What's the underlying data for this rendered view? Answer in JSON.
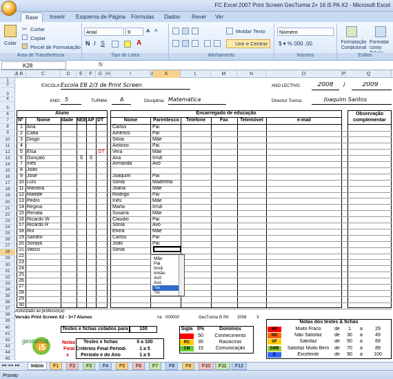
{
  "window": {
    "title": "FC Excel 2007 Print Screen GesTurma 2+ 16 i5 PA X2 - Microsoft Excel"
  },
  "ribbon": {
    "tabs": [
      "Base",
      "Inserir",
      "Esquema de Página",
      "Fórmulas",
      "Dados",
      "Rever",
      "Ver"
    ],
    "colar": "Colar",
    "cortar": "Cortar",
    "copiar": "Copiar",
    "pincel": "Pincel de Formatação",
    "font_name": "Arial",
    "font_size": "9",
    "font_group": "Tipo de Letra",
    "clip_group": "Área de Transferência",
    "moldar": "Moldar Texto",
    "unir": "Unir e Centrar",
    "align_group": "Alinhamento",
    "num_format": "Número",
    "num_group": "Número",
    "cond_format": "Formatação Condicional",
    "table_format": "Formatar como Tabela",
    "styles_group": "Estilos"
  },
  "formula": {
    "namebox": "K28",
    "fx": "fx",
    "value": ""
  },
  "columns": [
    "A",
    "B",
    "C",
    "D",
    "E",
    "F",
    "G",
    "H",
    "I",
    "J",
    "K",
    "L",
    "M",
    "N",
    "O",
    "P",
    "Q",
    "R"
  ],
  "rows": [
    "1",
    "2",
    "3",
    "4",
    "5",
    "6",
    "7",
    "8",
    "9",
    "10",
    "11",
    "12",
    "13",
    "14",
    "15",
    "16",
    "17",
    "18",
    "19",
    "20",
    "21",
    "22",
    "23",
    "24",
    "25",
    "26",
    "27",
    "28",
    "29",
    "30",
    "31",
    "32",
    "33",
    "34",
    "35",
    "36",
    "37",
    "38",
    "39",
    "40",
    "41",
    "42",
    "43",
    "44",
    "45"
  ],
  "header": {
    "escola_label": "ESCOLA:",
    "escola": "Escola EB 2/3 de Print Screen",
    "ano_lectivo_label": "ANO LECTIVO:",
    "year1": "2008",
    "slash": "/",
    "year2": "2009",
    "ano_label": "ANO:",
    "ano": "5",
    "turma_label": "TURMA:",
    "turma": "A",
    "disciplina_label": "Disciplina:",
    "disciplina": "Matemática",
    "director_label": "Director Turma:",
    "director": "Joaquim Santos"
  },
  "table_headers": {
    "aluno": "Aluno",
    "encarregado": "Encarregado de educação",
    "observacao": "Observação complementar",
    "n": "Nº",
    "nome": "Nome",
    "idade": "Idade",
    "nee": "NEE",
    "ap": "AP",
    "dt": "DT",
    "enc_nome": "Nome",
    "parentesco": "Parentesco",
    "telefone": "Telefone",
    "fax": "Fax",
    "telemovel": "Telemóvel",
    "email": "e-mail"
  },
  "students": [
    {
      "n": "1",
      "nome": "Ana",
      "nee": "",
      "ap": "",
      "dt": "",
      "enc": "Carlos",
      "par": "Pai"
    },
    {
      "n": "2",
      "nome": "Cátia",
      "nee": "",
      "ap": "",
      "dt": "",
      "enc": "Américo",
      "par": "Pai"
    },
    {
      "n": "3",
      "nome": "Diogo",
      "nee": "",
      "ap": "",
      "dt": "",
      "enc": "Silvia",
      "par": "Mãe"
    },
    {
      "n": "4",
      "nome": "",
      "nee": "",
      "ap": "",
      "dt": "",
      "enc": "António",
      "par": "Pai"
    },
    {
      "n": "5",
      "nome": "Elsa",
      "nee": "",
      "ap": "",
      "dt": "DT",
      "enc": "Vera",
      "par": "Mãe"
    },
    {
      "n": "6",
      "nome": "Gonçalo",
      "nee": "S",
      "ap": "S",
      "dt": "",
      "enc": "Ana",
      "par": "Irmã"
    },
    {
      "n": "7",
      "nome": "Inês",
      "nee": "",
      "ap": "",
      "dt": "",
      "enc": "Armanda",
      "par": "Avó"
    },
    {
      "n": "8",
      "nome": "João",
      "nee": "",
      "ap": "",
      "dt": "",
      "enc": "",
      "par": ""
    },
    {
      "n": "9",
      "nome": "José",
      "nee": "",
      "ap": "",
      "dt": "",
      "enc": "Joaquim",
      "par": "Pai"
    },
    {
      "n": "10",
      "nome": "Luís",
      "nee": "",
      "ap": "",
      "dt": "",
      "enc": "Sónia",
      "par": "Madrinha"
    },
    {
      "n": "11",
      "nome": "Mariana",
      "nee": "",
      "ap": "",
      "dt": "",
      "enc": "Joana",
      "par": "Mãe"
    },
    {
      "n": "12",
      "nome": "Matilde",
      "nee": "",
      "ap": "",
      "dt": "",
      "enc": "Rodrigo",
      "par": "Pai"
    },
    {
      "n": "13",
      "nome": "Pedro",
      "nee": "",
      "ap": "",
      "dt": "",
      "enc": "Inês",
      "par": "Mãe"
    },
    {
      "n": "14",
      "nome": "Regina",
      "nee": "",
      "ap": "",
      "dt": "",
      "enc": "Marta",
      "par": "Irmã"
    },
    {
      "n": "15",
      "nome": "Renata",
      "nee": "",
      "ap": "",
      "dt": "",
      "enc": "Susana",
      "par": "Mãe"
    },
    {
      "n": "16",
      "nome": "Ricardo W",
      "nee": "",
      "ap": "",
      "dt": "",
      "enc": "Claudio",
      "par": "Pai"
    },
    {
      "n": "17",
      "nome": "Ricardo R",
      "nee": "",
      "ap": "",
      "dt": "",
      "enc": "Sónia",
      "par": "Avó"
    },
    {
      "n": "18",
      "nome": "Rui",
      "nee": "",
      "ap": "",
      "dt": "",
      "enc": "Elvira",
      "par": "Mãe"
    },
    {
      "n": "19",
      "nome": "Sandro",
      "nee": "",
      "ap": "",
      "dt": "",
      "enc": "Carlos",
      "par": "Pai"
    },
    {
      "n": "20",
      "nome": "Soraya",
      "nee": "",
      "ap": "",
      "dt": "",
      "enc": "João",
      "par": "Pai"
    },
    {
      "n": "21",
      "nome": "Vasco",
      "nee": "",
      "ap": "",
      "dt": "",
      "enc": "Sónia",
      "par": ""
    },
    {
      "n": "22"
    },
    {
      "n": "23"
    },
    {
      "n": "24"
    },
    {
      "n": "25"
    },
    {
      "n": "26"
    },
    {
      "n": "27"
    },
    {
      "n": "28"
    },
    {
      "n": "29"
    },
    {
      "n": "30"
    }
  ],
  "dropdown": {
    "items": [
      "Mãe",
      "Pai",
      "Irmã",
      "Irmão",
      "Avô",
      "Avó",
      "Tia",
      "Tio"
    ],
    "selected": "Tia"
  },
  "footer": {
    "autorizado": "Autorizado ao professor(a):",
    "versao": "Versão Print Screen X2 - 3+7 Alunos",
    "na": "na",
    "na_num": "000000",
    "gesturma": "GesTurma i5 PA",
    "year": "2008",
    "x": "X",
    "testes_label": "Testes e fichas cotados para",
    "testes_val": "100",
    "notas": "Notas",
    "final": "Final",
    "s": "s",
    "tf_label": "Testes e fichas",
    "tf_val": "0 a 100",
    "cfp_label": "Critérios Final Período",
    "cfp_val": "1 a 5",
    "pa_label": "Período e do Ano",
    "pa_val": "1 a 5"
  },
  "siglas": {
    "h1": "Sigla",
    "h2": "0%",
    "h3": "Domínios",
    "rows": [
      {
        "s": "",
        "p": "50",
        "d": "Conhecimento",
        "c": "#ff0000"
      },
      {
        "s": "RC",
        "p": "35",
        "d": "Raciocínio",
        "c": "#ffcc00"
      },
      {
        "s": "CM",
        "p": "15",
        "d": "Comunicação",
        "c": "#66cc33"
      }
    ]
  },
  "notas": {
    "title": "Notas dos testes & fichas",
    "rows": [
      {
        "s": "MF",
        "t": "Muito Fraco",
        "de": "1",
        "a": "29",
        "c": "#ff0000"
      },
      {
        "s": "NS",
        "t": "Não Satisfaz",
        "de": "30",
        "a": "49",
        "c": "#ff6600"
      },
      {
        "s": "SF",
        "t": "Satisfaz",
        "de": "50",
        "a": "69",
        "c": "#ffcc00"
      },
      {
        "s": "SMB",
        "t": "Satisfaz Muito Bem",
        "de": "70",
        "a": "89",
        "c": "#99cc33"
      },
      {
        "s": "E",
        "t": "Excelente",
        "de": "90",
        "a": "100",
        "c": "#3366ff"
      }
    ],
    "de_label": "de",
    "a_label": "a"
  },
  "sheets": [
    "Início",
    "F1",
    "F2",
    "F3",
    "F4",
    "F5",
    "F6",
    "F7",
    "F8",
    "F9",
    "F10",
    "F11",
    "F12"
  ],
  "status": "Pronto",
  "logo": {
    "text": "gesturma",
    "num": "i5"
  }
}
